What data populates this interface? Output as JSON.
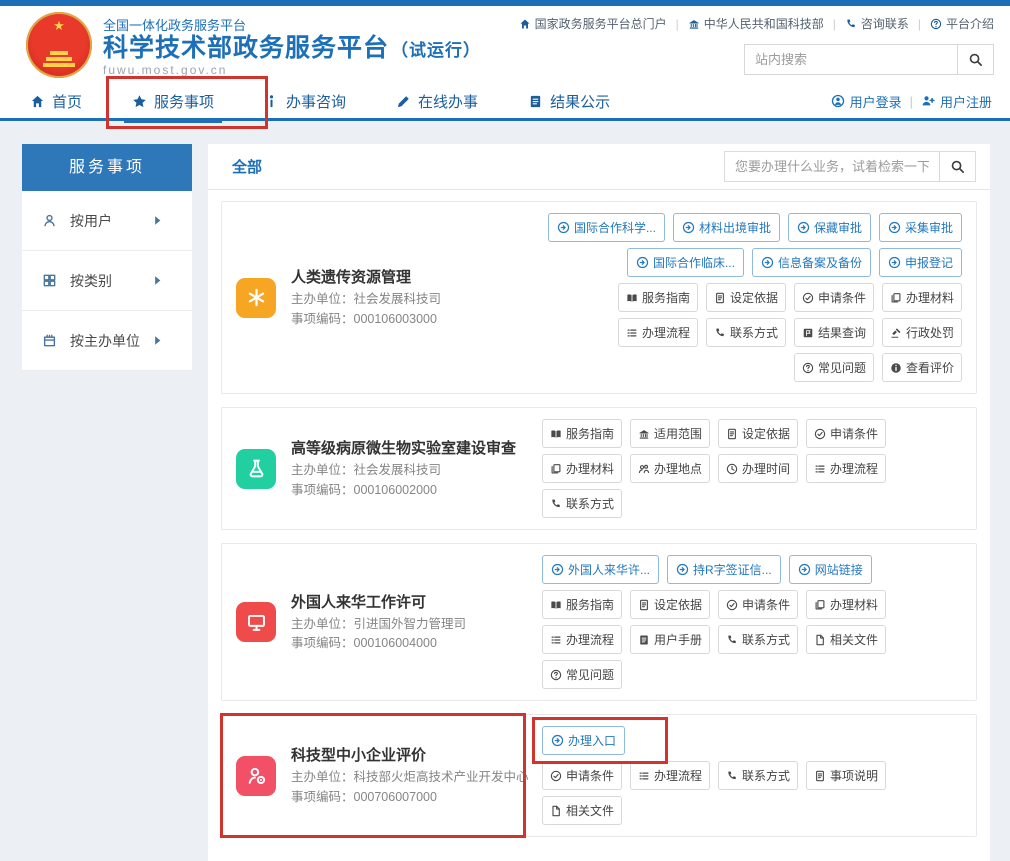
{
  "topbar": {
    "links": [
      {
        "name": "national-portal",
        "icon": "home-icon",
        "label": "国家政务服务平台总门户"
      },
      {
        "name": "most",
        "icon": "bank-icon",
        "label": "中华人民共和国科技部"
      },
      {
        "name": "contact",
        "icon": "phone-icon",
        "label": "咨询联系"
      },
      {
        "name": "about",
        "icon": "question-circle-icon",
        "label": "平台介绍"
      }
    ]
  },
  "header": {
    "platform_small": "全国一体化政务服务平台",
    "title": "科学技术部政务服务平台",
    "suffix": "（试运行）",
    "url": "fuwu.most.gov.cn",
    "site_search_placeholder": "站内搜索"
  },
  "nav": {
    "items": [
      {
        "name": "home",
        "icon": "home-icon",
        "label": "首页",
        "active": false,
        "annotated": false
      },
      {
        "name": "service-items",
        "icon": "star-icon",
        "label": "服务事项",
        "active": true,
        "annotated": true
      },
      {
        "name": "consultation",
        "icon": "info-icon",
        "label": "办事咨询",
        "active": false,
        "annotated": false
      },
      {
        "name": "online-services",
        "icon": "pencil-icon",
        "label": "在线办事",
        "active": false,
        "annotated": false
      },
      {
        "name": "results",
        "icon": "journal-icon",
        "label": "结果公示",
        "active": false,
        "annotated": false
      }
    ],
    "login_label": "用户登录",
    "register_label": "用户注册"
  },
  "sidebar": {
    "title": "服务事项",
    "items": [
      {
        "name": "by-user",
        "icon": "user-icon",
        "label": "按用户"
      },
      {
        "name": "by-category",
        "icon": "grid-icon",
        "label": "按类别"
      },
      {
        "name": "by-host-org",
        "icon": "building-icon",
        "label": "按主办单位"
      }
    ]
  },
  "main": {
    "tab": "全部",
    "search_placeholder": "您要办理什么业务，试着检索一下",
    "cards": [
      {
        "icon": "snowflake-icon",
        "icon_bg": "#F7A623",
        "highlighted": false,
        "title": "人类遗传资源管理",
        "org": "主办单位：社会发展科技司",
        "code": "事项编码：000106003000",
        "tags_align": "right",
        "tags": [
          {
            "label": "国际合作科学...",
            "annotated": false
          },
          {
            "label": "材料出境审批",
            "annotated": false
          },
          {
            "label": "保藏审批",
            "annotated": false
          },
          {
            "label": "采集审批",
            "annotated": false
          },
          {
            "label": "国际合作临床...",
            "annotated": false
          },
          {
            "label": "信息备案及备份",
            "annotated": false
          },
          {
            "label": "申报登记",
            "annotated": false
          }
        ],
        "actions_align": "right",
        "actions": [
          {
            "icon": "open-book-icon",
            "label": "服务指南"
          },
          {
            "icon": "document-icon",
            "label": "设定依据"
          },
          {
            "icon": "check-circle-icon",
            "label": "申请条件"
          },
          {
            "icon": "copy-icon",
            "label": "办理材料"
          },
          {
            "icon": "list-icon",
            "label": "办理流程"
          },
          {
            "icon": "phone-icon",
            "label": "联系方式"
          },
          {
            "icon": "flag-icon",
            "label": "结果查询"
          },
          {
            "icon": "gavel-icon",
            "label": "行政处罚"
          },
          {
            "icon": "question-circle-icon",
            "label": "常见问题"
          },
          {
            "icon": "info-circle-icon",
            "label": "查看评价"
          }
        ]
      },
      {
        "icon": "flask-icon",
        "icon_bg": "#21CFA0",
        "highlighted": false,
        "title": "高等级病原微生物实验室建设审查",
        "org": "主办单位：社会发展科技司",
        "code": "事项编码：000106002000",
        "tags_align": "right",
        "tags": [],
        "actions_align": "left",
        "actions": [
          {
            "icon": "open-book-icon",
            "label": "服务指南"
          },
          {
            "icon": "bank-icon",
            "label": "适用范围"
          },
          {
            "icon": "document-icon",
            "label": "设定依据"
          },
          {
            "icon": "check-circle-icon",
            "label": "申请条件"
          },
          {
            "icon": "copy-icon",
            "label": "办理材料"
          },
          {
            "icon": "people-icon",
            "label": "办理地点"
          },
          {
            "icon": "clock-icon",
            "label": "办理时间"
          },
          {
            "icon": "list-icon",
            "label": "办理流程"
          },
          {
            "icon": "phone-icon",
            "label": "联系方式"
          }
        ]
      },
      {
        "icon": "monitor-icon",
        "icon_bg": "#F04B4B",
        "highlighted": false,
        "title": "外国人来华工作许可",
        "org": "主办单位：引进国外智力管理司",
        "code": "事项编码：000106004000",
        "tags_align": "left",
        "tags": [
          {
            "label": "外国人来华许...",
            "annotated": false
          },
          {
            "label": "持R字签证信...",
            "annotated": false
          },
          {
            "label": "网站链接",
            "annotated": false
          }
        ],
        "actions_align": "left",
        "actions": [
          {
            "icon": "open-book-icon",
            "label": "服务指南"
          },
          {
            "icon": "document-icon",
            "label": "设定依据"
          },
          {
            "icon": "check-circle-icon",
            "label": "申请条件"
          },
          {
            "icon": "copy-icon",
            "label": "办理材料"
          },
          {
            "icon": "list-icon",
            "label": "办理流程"
          },
          {
            "icon": "journal-icon",
            "label": "用户手册"
          },
          {
            "icon": "phone-icon",
            "label": "联系方式"
          },
          {
            "icon": "file-icon",
            "label": "相关文件"
          },
          {
            "icon": "question-circle-icon",
            "label": "常见问题"
          }
        ]
      },
      {
        "icon": "user-gear-icon",
        "icon_bg": "#F25066",
        "highlighted": true,
        "title": "科技型中小企业评价",
        "org": "主办单位：科技部火炬高技术产业开发中心",
        "code": "事项编码：000706007000",
        "tags_align": "left",
        "tags": [
          {
            "label": "办理入口",
            "annotated": true
          }
        ],
        "actions_align": "left",
        "actions": [
          {
            "icon": "check-circle-icon",
            "label": "申请条件"
          },
          {
            "icon": "list-icon",
            "label": "办理流程"
          },
          {
            "icon": "phone-icon",
            "label": "联系方式"
          },
          {
            "icon": "document-icon",
            "label": "事项说明"
          },
          {
            "icon": "file-icon",
            "label": "相关文件"
          }
        ]
      }
    ]
  },
  "colors": {
    "brand_blue": "#1D6FB8",
    "nav_blue": "#1B5E9E",
    "sidebar_header_blue": "#2E77B8",
    "tag_blue": "#2478BE",
    "annotation_red": "#D0342C",
    "card_icon_orange": "#F7A623",
    "card_icon_green": "#21CFA0",
    "card_icon_red": "#F04B4B",
    "card_icon_pink": "#F25066"
  }
}
